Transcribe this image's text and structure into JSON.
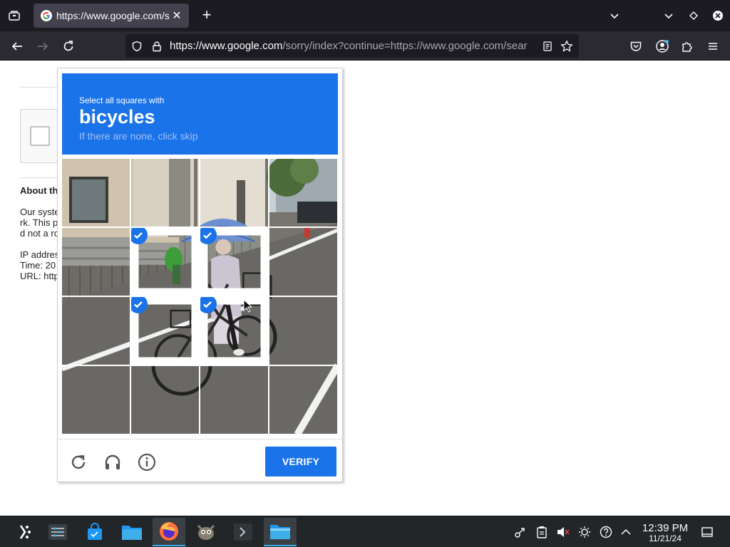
{
  "browser": {
    "tab": {
      "title": "https://www.google.com/s",
      "close": "✕"
    },
    "new_tab": "+",
    "url": {
      "host": "https://www.google.com",
      "path": "/sorry/index?continue=https://www.google.com/sear"
    }
  },
  "page": {
    "about_heading": "About th",
    "body_lines": [
      "Our syste",
      "rk. This p",
      "d not a ro"
    ],
    "info_lines": [
      "IP addres",
      "Time: 20",
      "URL: http"
    ]
  },
  "captcha": {
    "instruction": "Select all squares with",
    "keyword": "bicycles",
    "hint": "If there are none, click skip",
    "verify_label": "VERIFY",
    "selected_tiles": [
      5,
      6,
      9,
      10
    ],
    "grid_size": 4
  },
  "taskbar": {
    "clock": {
      "time": "12:39 PM",
      "date": "11/21/24"
    }
  },
  "colors": {
    "accent": "#1a73e8",
    "tabbar": "#1c1b22",
    "navbar": "#2b2a33",
    "taskbar": "#232629"
  }
}
